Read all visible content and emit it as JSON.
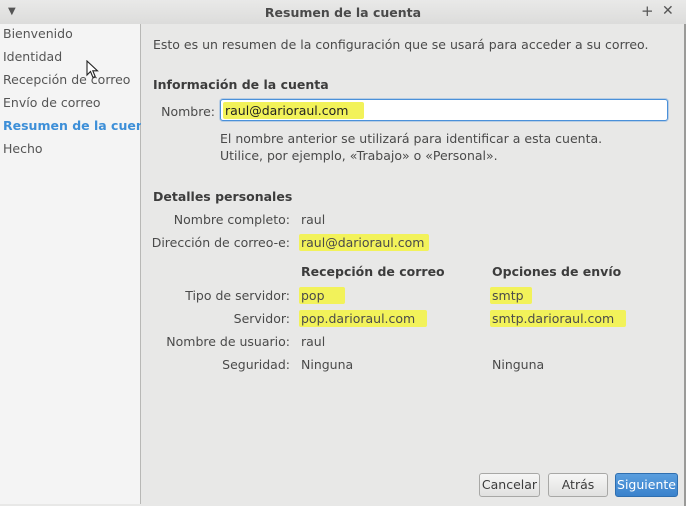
{
  "window": {
    "title": "Resumen de la cuenta"
  },
  "sidebar": {
    "items": [
      {
        "label": "Bienvenido"
      },
      {
        "label": "Identidad"
      },
      {
        "label": "Recepción de correo"
      },
      {
        "label": "Envío de correo"
      },
      {
        "label": "Resumen de la cuenta",
        "active": true
      },
      {
        "label": "Hecho"
      }
    ]
  },
  "main": {
    "intro": "Esto es un resumen de la configuración que se usará para acceder a su correo.",
    "account_info": {
      "heading": "Información de la cuenta",
      "name_label": "Nombre:",
      "name_value": "raul@darioraul.com",
      "hint_line1": "El nombre anterior se utilizará para identificar a esta cuenta.",
      "hint_line2": "Utilice, por ejemplo, «Trabajo» o «Personal»."
    },
    "personal": {
      "heading": "Detalles personales",
      "fullname_label": "Nombre completo:",
      "fullname_value": "raul",
      "email_label": "Dirección de correo-e:",
      "email_value": "raul@darioraul.com"
    },
    "servers": {
      "incoming_heading": "Recepción de correo",
      "outgoing_heading": "Opciones de envío",
      "type_label": "Tipo de servidor:",
      "type_in": "pop",
      "type_out": "smtp",
      "server_label": "Servidor:",
      "server_in": "pop.darioraul.com",
      "server_out": "smtp.darioraul.com",
      "user_label": "Nombre de usuario:",
      "user_in": "raul",
      "security_label": "Seguridad:",
      "security_in": "Ninguna",
      "security_out": "Ninguna"
    }
  },
  "buttons": {
    "cancel": "Cancelar",
    "back": "Atrás",
    "next": "Siguiente"
  },
  "colors": {
    "highlight": "#f2f25a",
    "accent": "#3d8fd8",
    "primary_button": "#4a90d9"
  }
}
